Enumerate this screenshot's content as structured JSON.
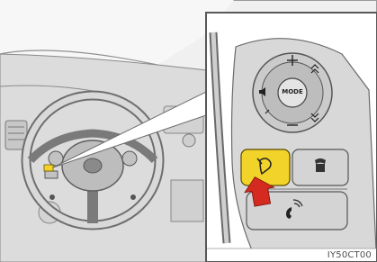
{
  "figure": {
    "image_code": "IY50CT00",
    "mode_button_label": "MODE",
    "highlight_color": "#f2d32a",
    "arrow_color": "#d52a20"
  }
}
